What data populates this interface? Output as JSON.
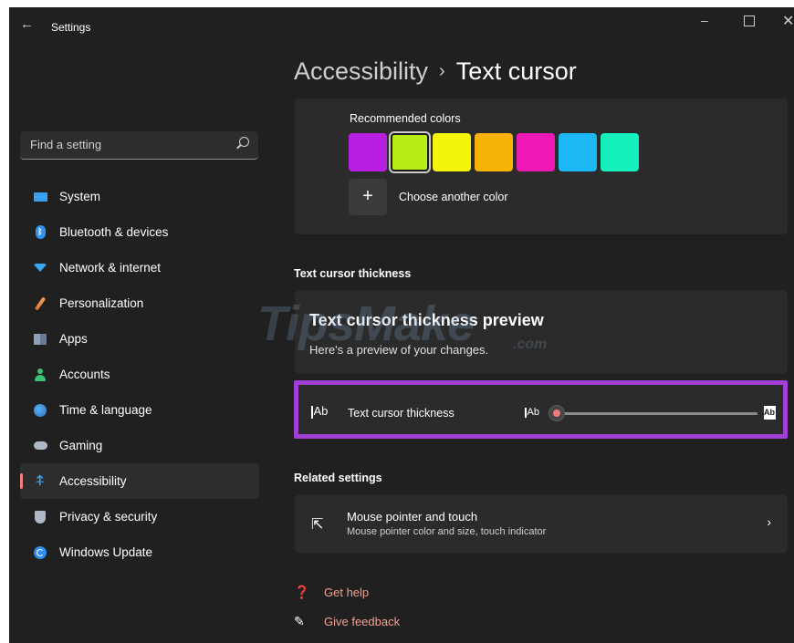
{
  "window": {
    "back_glyph": "←",
    "title": "Settings",
    "minimize_glyph": "–",
    "close_glyph": "✕"
  },
  "search": {
    "placeholder": "Find a setting"
  },
  "sidebar": {
    "items": [
      {
        "label": "System",
        "icon": "monitor-icon"
      },
      {
        "label": "Bluetooth & devices",
        "icon": "bluetooth-icon"
      },
      {
        "label": "Network & internet",
        "icon": "wifi-icon"
      },
      {
        "label": "Personalization",
        "icon": "brush-icon"
      },
      {
        "label": "Apps",
        "icon": "apps-icon"
      },
      {
        "label": "Accounts",
        "icon": "person-icon"
      },
      {
        "label": "Time & language",
        "icon": "globe-clock-icon"
      },
      {
        "label": "Gaming",
        "icon": "controller-icon"
      },
      {
        "label": "Accessibility",
        "icon": "accessibility-icon",
        "active": true
      },
      {
        "label": "Privacy & security",
        "icon": "shield-icon"
      },
      {
        "label": "Windows Update",
        "icon": "update-icon"
      }
    ]
  },
  "breadcrumb": {
    "parent": "Accessibility",
    "separator": "›",
    "current": "Text cursor"
  },
  "colors": {
    "label": "Recommended colors",
    "swatches": [
      "#b81fe0",
      "#b8ec16",
      "#f4f40c",
      "#f7b207",
      "#f019b6",
      "#1cb8f5",
      "#15f0bc"
    ],
    "selected_index": 1,
    "add_glyph": "+",
    "add_label": "Choose another color"
  },
  "thickness_section": {
    "heading": "Text cursor thickness",
    "preview_title": "Text cursor thickness preview",
    "preview_subtitle": "Here's a preview of your changes.",
    "watermark": "TipsMake",
    "watermark_suffix": ".com",
    "setting_icon_text": "Ab",
    "setting_label": "Text cursor thickness",
    "slider_min_icon_text": "Ab",
    "slider_max_icon_text": "Ab",
    "slider_value": 0,
    "highlight_color": "#a13fd6"
  },
  "related": {
    "heading": "Related settings",
    "mouse_title": "Mouse pointer and touch",
    "mouse_subtitle": "Mouse pointer color and size, touch indicator",
    "chevron": "›"
  },
  "links": {
    "help": "Get help",
    "feedback": "Give feedback"
  }
}
